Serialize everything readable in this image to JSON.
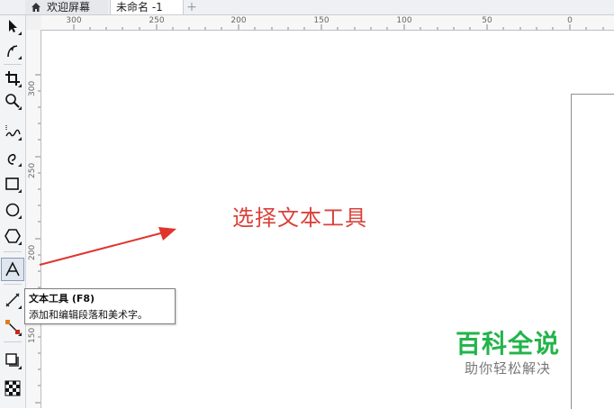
{
  "tabs": {
    "home_label": "欢迎屏幕",
    "doc_label": "未命名 -1",
    "add_label": "+"
  },
  "toolbox": {
    "tools": [
      {
        "name": "pick-tool",
        "icon": "pointer-icon"
      },
      {
        "name": "shape-tool",
        "icon": "node-edit-icon"
      },
      {
        "name": "crop-tool",
        "icon": "crop-icon"
      },
      {
        "name": "zoom-tool",
        "icon": "magnifier-icon"
      },
      {
        "name": "freehand-tool",
        "icon": "freehand-icon"
      },
      {
        "name": "artistic-media-tool",
        "icon": "curve-icon"
      },
      {
        "name": "rectangle-tool",
        "icon": "rectangle-icon"
      },
      {
        "name": "ellipse-tool",
        "icon": "ellipse-icon"
      },
      {
        "name": "polygon-tool",
        "icon": "polygon-icon"
      },
      {
        "name": "text-tool",
        "icon": "text-a-icon",
        "selected": true
      },
      {
        "name": "parallel-dimension-tool",
        "icon": "dimension-line-icon"
      },
      {
        "name": "connector-tool",
        "icon": "connector-icon"
      },
      {
        "name": "drop-shadow-tool",
        "icon": "shadow-icon"
      },
      {
        "name": "transparency-tool",
        "icon": "checker-icon"
      }
    ]
  },
  "ruler": {
    "horizontal_labels": [
      "300",
      "250",
      "200",
      "150",
      "100",
      "50",
      "0"
    ],
    "vertical_labels": [
      "300",
      "250",
      "200",
      "150"
    ]
  },
  "annotation": {
    "text": "选择文本工具",
    "color": "#d9423b"
  },
  "tooltip": {
    "title": "文本工具 (F8)",
    "description": "添加和编辑段落和美术字。"
  },
  "watermark": {
    "title": "百科全说",
    "subtitle": "助你轻松解决",
    "title_color": "#23b44a"
  }
}
